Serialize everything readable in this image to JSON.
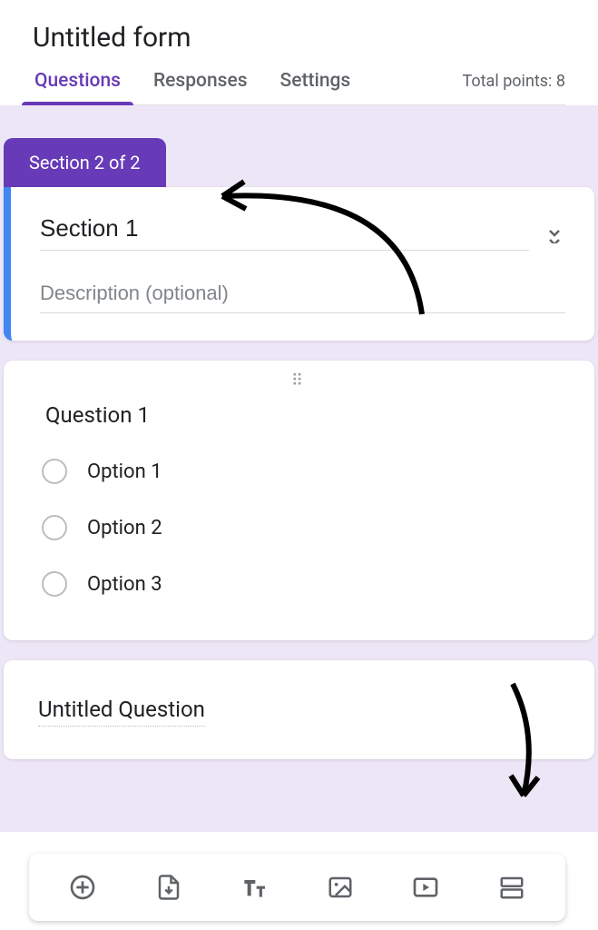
{
  "form": {
    "title": "Untitled form"
  },
  "tabs": {
    "questions": "Questions",
    "responses": "Responses",
    "settings": "Settings"
  },
  "points_label": "Total points: 8",
  "section_chip": "Section 2 of 2",
  "section": {
    "title": "Section 1",
    "description_placeholder": "Description (optional)"
  },
  "question1": {
    "title": "Question 1",
    "options": [
      "Option 1",
      "Option 2",
      "Option 3"
    ]
  },
  "question2": {
    "title": "Untitled Question"
  },
  "toolbar": {
    "add_question": "add-question",
    "import": "import-questions",
    "text": "add-title",
    "image": "add-image",
    "video": "add-video",
    "section": "add-section"
  }
}
